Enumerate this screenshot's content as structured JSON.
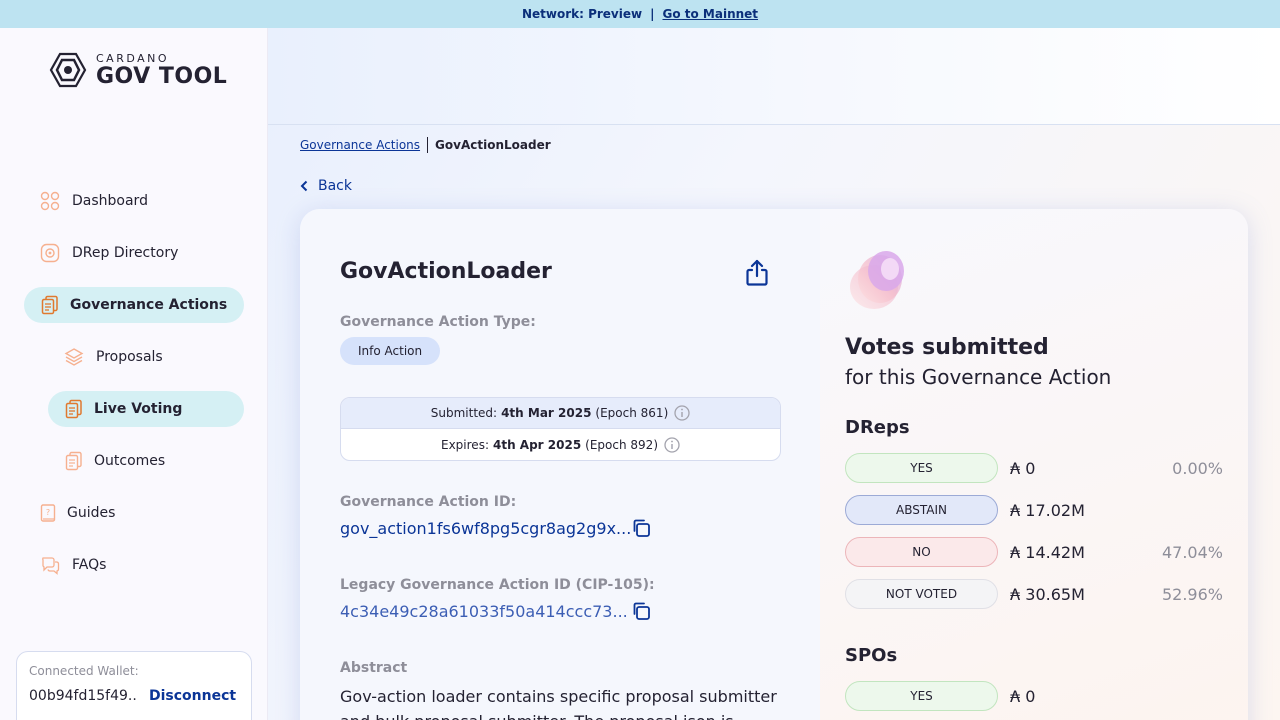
{
  "topbar": {
    "network": "Network: Preview",
    "separator": "|",
    "mainnet_link": "Go to Mainnet"
  },
  "logo": {
    "small": "CARDANO",
    "big": "GOV TOOL"
  },
  "sidebar": {
    "items": [
      {
        "label": "Dashboard"
      },
      {
        "label": "DRep Directory"
      },
      {
        "label": "Governance Actions"
      },
      {
        "label": "Proposals"
      },
      {
        "label": "Live Voting"
      },
      {
        "label": "Outcomes"
      },
      {
        "label": "Guides"
      },
      {
        "label": "FAQs"
      }
    ]
  },
  "wallet": {
    "label": "Connected Wallet:",
    "address": "00b94fd15f49...",
    "disconnect": "Disconnect"
  },
  "breadcrumb": {
    "parent": "Governance Actions",
    "current": "GovActionLoader"
  },
  "back": "Back",
  "action": {
    "title": "GovActionLoader",
    "type_label": "Governance Action Type:",
    "type_value": "Info Action",
    "submitted": {
      "prefix": "Submitted:",
      "date": "4th Mar 2025",
      "epoch": "(Epoch 861)"
    },
    "expires": {
      "prefix": "Expires:",
      "date": "4th Apr 2025",
      "epoch": "(Epoch 892)"
    },
    "id_label": "Governance Action ID:",
    "id_value": "gov_action1fs6wf8pg5cgr8ag2g9x...",
    "legacy_label": "Legacy Governance Action ID (CIP-105):",
    "legacy_value": "4c34e49c28a61033f50a414ccc73...",
    "abstract_label": "Abstract",
    "abstract_text": "Gov-action loader contains specific proposal submitter and bulk proposal submitter. The proposal json is"
  },
  "votes": {
    "title": "Votes submitted",
    "subtitle": "for this Governance Action",
    "dreps_label": "DReps",
    "dreps": [
      {
        "label": "YES",
        "amount": "₳ 0",
        "percent": "0.00%"
      },
      {
        "label": "ABSTAIN",
        "amount": "₳ 17.02M",
        "percent": ""
      },
      {
        "label": "NO",
        "amount": "₳ 14.42M",
        "percent": "47.04%"
      },
      {
        "label": "NOT VOTED",
        "amount": "₳ 30.65M",
        "percent": "52.96%"
      }
    ],
    "spos_label": "SPOs",
    "spos": [
      {
        "label": "YES",
        "amount": "₳ 0",
        "percent": ""
      }
    ]
  },
  "colors": {
    "accent": "#0b3597",
    "active_nav": "#d5f0f4",
    "topbar": "#bde3f1"
  },
  "icons": [
    "dashboard-icon",
    "drep-directory-icon",
    "governance-actions-icon",
    "proposals-icon",
    "live-voting-icon",
    "outcomes-icon",
    "guides-icon",
    "faqs-icon",
    "share-icon",
    "info-icon",
    "copy-icon",
    "chevron-left-icon"
  ]
}
